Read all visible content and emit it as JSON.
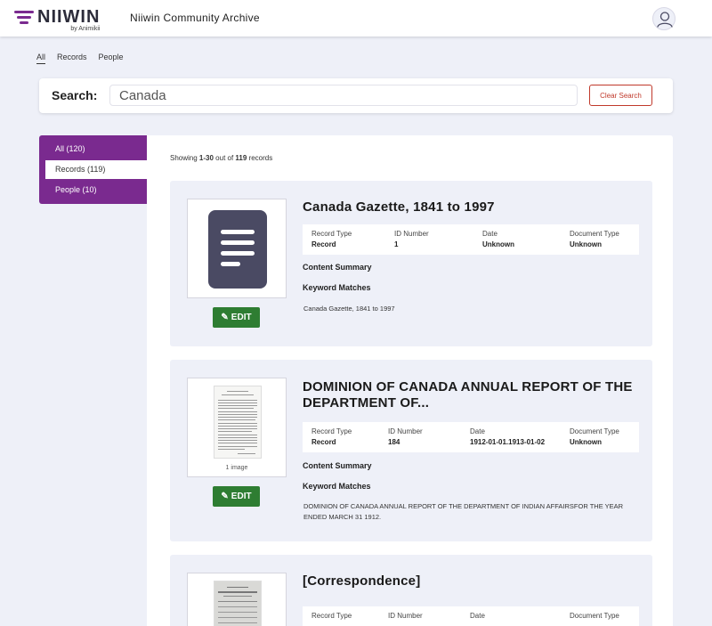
{
  "header": {
    "logo_name": "NIIWIN",
    "logo_sub": "by Animikii",
    "app_title": "Niiwin Community Archive"
  },
  "tabs": [
    "All",
    "Records",
    "People"
  ],
  "search": {
    "label": "Search:",
    "value": "Canada",
    "clear_label": "Clear Search"
  },
  "sidebar": {
    "items": [
      {
        "label": "All (120)"
      },
      {
        "label": "Records (119)"
      },
      {
        "label": "People (10)"
      }
    ]
  },
  "results": {
    "showing_prefix": "Showing",
    "range": "1-30",
    "mid": "out of",
    "total": "119",
    "suffix": "records"
  },
  "labels": {
    "record_type": "Record Type",
    "id_number": "ID Number",
    "date": "Date",
    "document_type": "Document Type",
    "content_summary": "Content Summary",
    "keyword_matches": "Keyword Matches",
    "edit": "EDIT"
  },
  "records": [
    {
      "title": "Canada Gazette, 1841 to 1997",
      "record_type": "Record",
      "id_number": "1",
      "date": "Unknown",
      "document_type": "Unknown",
      "keyword_match": "Canada Gazette, 1841 to 1997"
    },
    {
      "title": "DOMINION OF CANADA ANNUAL REPORT OF THE DEPARTMENT OF...",
      "record_type": "Record",
      "id_number": "184",
      "date": "1912-01-01.1913-01-02",
      "document_type": "Unknown",
      "thumb_caption": "1 image",
      "keyword_match": "DOMINION OF CANADA ANNUAL REPORT OF THE DEPARTMENT OF INDIAN AFFAIRSFOR THE YEAR ENDED MARCH 31 1912."
    },
    {
      "title": "[Correspondence]"
    }
  ],
  "colors": {
    "brand_purple": "#7a2a8f",
    "edit_green": "#2e7d32",
    "clear_red": "#c0392b",
    "page_bg": "#eef0f8",
    "doc_icon": "#4a4a63"
  }
}
